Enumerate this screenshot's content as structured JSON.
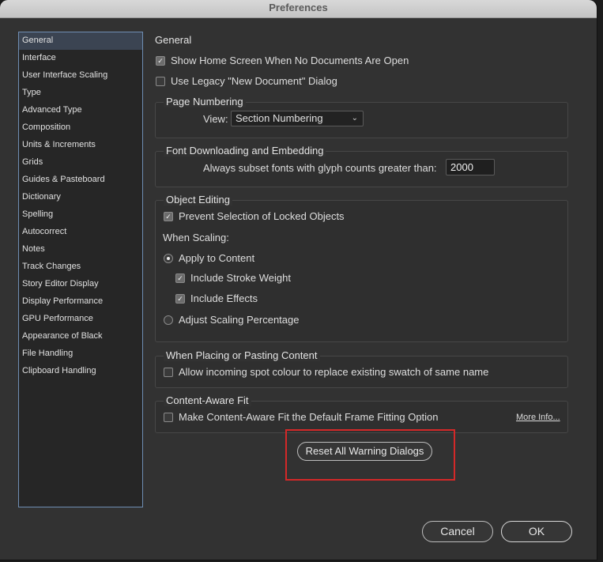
{
  "window": {
    "title": "Preferences"
  },
  "sidebar": {
    "items": [
      {
        "label": "General",
        "selected": true
      },
      {
        "label": "Interface"
      },
      {
        "label": "User Interface Scaling"
      },
      {
        "label": "Type"
      },
      {
        "label": "Advanced Type"
      },
      {
        "label": "Composition"
      },
      {
        "label": "Units & Increments"
      },
      {
        "label": "Grids"
      },
      {
        "label": "Guides & Pasteboard"
      },
      {
        "label": "Dictionary"
      },
      {
        "label": "Spelling"
      },
      {
        "label": "Autocorrect"
      },
      {
        "label": "Notes"
      },
      {
        "label": "Track Changes"
      },
      {
        "label": "Story Editor Display"
      },
      {
        "label": "Display Performance"
      },
      {
        "label": "GPU Performance"
      },
      {
        "label": "Appearance of Black"
      },
      {
        "label": "File Handling"
      },
      {
        "label": "Clipboard Handling"
      }
    ]
  },
  "general": {
    "title": "General",
    "show_home_screen": {
      "label": "Show Home Screen When No Documents Are Open",
      "checked": true
    },
    "legacy_new_doc": {
      "label": "Use Legacy \"New Document\" Dialog",
      "checked": false
    }
  },
  "page_numbering": {
    "title": "Page Numbering",
    "view_label": "View:",
    "view_value": "Section Numbering"
  },
  "font_downloading": {
    "title": "Font Downloading and Embedding",
    "subset_label": "Always subset fonts with glyph counts greater than:",
    "subset_value": "2000"
  },
  "object_editing": {
    "title": "Object Editing",
    "prevent_selection": {
      "label": "Prevent Selection of Locked Objects",
      "checked": true
    },
    "when_scaling": "When Scaling:",
    "apply_to_content": {
      "label": "Apply to Content",
      "selected": true
    },
    "include_stroke": {
      "label": "Include Stroke Weight",
      "checked": true
    },
    "include_effects": {
      "label": "Include Effects",
      "checked": true
    },
    "adjust_scaling": {
      "label": "Adjust Scaling Percentage",
      "selected": false
    }
  },
  "placing": {
    "title": "When Placing or Pasting Content",
    "spot_colour": {
      "label": "Allow incoming spot colour to replace existing swatch of same name",
      "checked": false
    }
  },
  "content_aware": {
    "title": "Content-Aware Fit",
    "make_default": {
      "label": "Make Content-Aware Fit the Default Frame Fitting Option",
      "checked": false
    },
    "more_info": "More Info..."
  },
  "buttons": {
    "reset_warnings": "Reset All Warning Dialogs",
    "cancel": "Cancel",
    "ok": "OK"
  },
  "colors": {
    "highlight_box": "#d42828",
    "sidebar_border": "#6f8eb3",
    "dialog_bg": "#323232"
  }
}
